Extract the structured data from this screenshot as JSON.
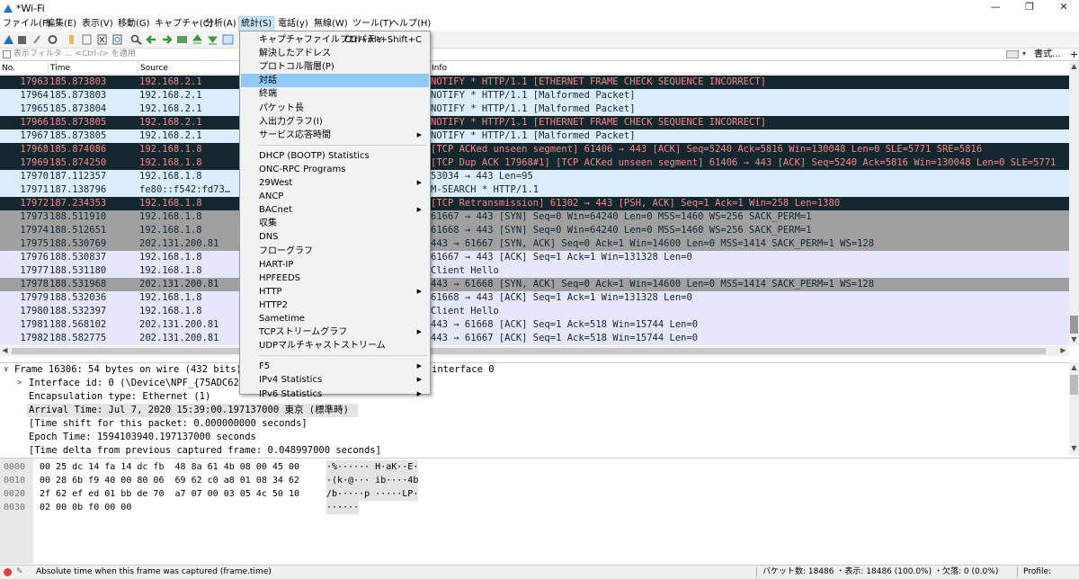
{
  "window": {
    "title": "*Wi-Fi",
    "min": "—",
    "max": "❐",
    "close": "✕"
  },
  "menubar": [
    {
      "label": "ファイル(F)"
    },
    {
      "label": "編集(E)"
    },
    {
      "label": "表示(V)"
    },
    {
      "label": "移動(G)"
    },
    {
      "label": "キャプチャ(C)"
    },
    {
      "label": "分析(A)"
    },
    {
      "label": "統計(S)"
    },
    {
      "label": "電話(y)"
    },
    {
      "label": "無線(W)"
    },
    {
      "label": "ツール(T)"
    },
    {
      "label": "ヘルプ(H)"
    }
  ],
  "filter": {
    "placeholder": "表示フィルタ … <Ctrl-/> を適用",
    "expression_label": "書式…",
    "plus": "+",
    "dropdown": "▾"
  },
  "columns": {
    "no": "No.",
    "time": "Time",
    "source": "Source",
    "info": "Info"
  },
  "packets": [
    {
      "no": "17963",
      "time": "185.873803",
      "src": "192.168.2.1",
      "info": "NOTIFY * HTTP/1.1  [ETHERNET FRAME CHECK SEQUENCE INCORRECT]",
      "style": "black"
    },
    {
      "no": "17964",
      "time": "185.873803",
      "src": "192.168.2.1",
      "info": "NOTIFY * HTTP/1.1 [Malformed Packet]",
      "style": "blue"
    },
    {
      "no": "17965",
      "time": "185.873804",
      "src": "192.168.2.1",
      "info": "NOTIFY * HTTP/1.1 [Malformed Packet]",
      "style": "blue"
    },
    {
      "no": "17966",
      "time": "185.873805",
      "src": "192.168.2.1",
      "info": "NOTIFY * HTTP/1.1  [ETHERNET FRAME CHECK SEQUENCE INCORRECT]",
      "style": "black"
    },
    {
      "no": "17967",
      "time": "185.873805",
      "src": "192.168.2.1",
      "info": "NOTIFY * HTTP/1.1 [Malformed Packet]",
      "style": "blue"
    },
    {
      "no": "17968",
      "time": "185.874086",
      "src": "192.168.1.8",
      "info": "[TCP ACKed unseen segment] 61406 → 443 [ACK] Seq=5240 Ack=5816 Win=130048 Len=0 SLE=5771 SRE=5816",
      "style": "black"
    },
    {
      "no": "17969",
      "time": "185.874250",
      "src": "192.168.1.8",
      "info": "[TCP Dup ACK 17968#1] [TCP ACKed unseen segment] 61406 → 443 [ACK] Seq=5240 Ack=5816 Win=130048 Len=0 SLE=5771",
      "style": "black"
    },
    {
      "no": "17970",
      "time": "187.112357",
      "src": "192.168.1.8",
      "info": "53034 → 443 Len=95",
      "style": "blue"
    },
    {
      "no": "17971",
      "time": "187.138796",
      "src": "fe80::f542:fd73…",
      "info": "M-SEARCH * HTTP/1.1",
      "style": "blue"
    },
    {
      "no": "17972",
      "time": "187.234353",
      "src": "192.168.1.8",
      "info": "[TCP Retransmission] 61302 → 443 [PSH, ACK] Seq=1 Ack=1 Win=258 Len=1380",
      "style": "black"
    },
    {
      "no": "17973",
      "time": "188.511910",
      "src": "192.168.1.8",
      "info": "61667 → 443 [SYN] Seq=0 Win=64240 Len=0 MSS=1460 WS=256 SACK_PERM=1",
      "style": "gray"
    },
    {
      "no": "17974",
      "time": "188.512651",
      "src": "192.168.1.8",
      "info": "61668 → 443 [SYN] Seq=0 Win=64240 Len=0 MSS=1460 WS=256 SACK_PERM=1",
      "style": "gray"
    },
    {
      "no": "17975",
      "time": "188.530769",
      "src": "202.131.200.81",
      "info": "443 → 61667 [SYN, ACK] Seq=0 Ack=1 Win=14600 Len=0 MSS=1414 SACK_PERM=1 WS=128",
      "style": "gray"
    },
    {
      "no": "17976",
      "time": "188.530837",
      "src": "192.168.1.8",
      "info": "61667 → 443 [ACK] Seq=1 Ack=1 Win=131328 Len=0",
      "style": "lav"
    },
    {
      "no": "17977",
      "time": "188.531180",
      "src": "192.168.1.8",
      "info": "Client Hello",
      "style": "lav"
    },
    {
      "no": "17978",
      "time": "188.531968",
      "src": "202.131.200.81",
      "info": "443 → 61668 [SYN, ACK] Seq=0 Ack=1 Win=14600 Len=0 MSS=1414 SACK_PERM=1 WS=128",
      "style": "gray"
    },
    {
      "no": "17979",
      "time": "188.532036",
      "src": "192.168.1.8",
      "info": "61668 → 443 [ACK] Seq=1 Ack=1 Win=131328 Len=0",
      "style": "lav"
    },
    {
      "no": "17980",
      "time": "188.532397",
      "src": "192.168.1.8",
      "info": "Client Hello",
      "style": "lav"
    },
    {
      "no": "17981",
      "time": "188.568102",
      "src": "202.131.200.81",
      "info": "443 → 61668 [ACK] Seq=1 Ack=518 Win=15744 Len=0",
      "style": "lav"
    },
    {
      "no": "17982",
      "time": "188.582775",
      "src": "202.131.200.81",
      "info": "443 → 61667 [ACK] Seq=1 Ack=518 Win=15744 Len=0",
      "style": "lav"
    }
  ],
  "details": [
    {
      "text": "Frame 16306: 54 bytes on wire (432 bits)",
      "expander": "∨",
      "indent": 0
    },
    {
      "text": "Interface id: 0 (\\Device\\NPF_{75ADC62",
      "expander": ">",
      "indent": 1
    },
    {
      "text": "Encapsulation type: Ethernet (1)",
      "expander": "",
      "indent": 1
    },
    {
      "text": "Arrival Time: Jul  7, 2020 15:39:00.197137000 東京 (標準時)",
      "expander": "",
      "indent": 1,
      "selected": true
    },
    {
      "text": "[Time shift for this packet: 0.000000000 seconds]",
      "expander": "",
      "indent": 1
    },
    {
      "text": "Epoch Time: 1594103940.197137000 seconds",
      "expander": "",
      "indent": 1
    },
    {
      "text": "[Time delta from previous captured frame: 0.048997000 seconds]",
      "expander": "",
      "indent": 1
    }
  ],
  "details_tail": "interface 0",
  "hex": [
    {
      "offset": "0000",
      "bytes": "00 25 dc 14 fa 14 dc fb  48 8a 61 4b 08 00 45 00",
      "ascii": "·%······ H·aK··E·"
    },
    {
      "offset": "0010",
      "bytes": "00 28 6b f9 40 00 80 06  69 62 c0 a8 01 08 34 62",
      "ascii": "·(k·@··· ib····4b"
    },
    {
      "offset": "0020",
      "bytes": "2f 62 ef ed 01 bb de 70  a7 07 00 03 05 4c 50 10",
      "ascii": "/b·····p ·····LP·"
    },
    {
      "offset": "0030",
      "bytes": "02 00 0b f0 00 00",
      "ascii": "······"
    }
  ],
  "statusbar": {
    "hint": "Absolute time when this frame was captured (frame.time)",
    "stats": "パケット数: 18486 ・表示: 18486 (100.0%) ・欠落: 0 (0.0%)",
    "profile": "Profile: Default"
  },
  "stats_menu": {
    "items": [
      {
        "label": "キャプチャファイルプロパティ",
        "shortcut": "Ctrl+Alt+Shift+C"
      },
      {
        "label": "解決したアドレス"
      },
      {
        "label": "プロトコル階層(P)"
      },
      {
        "label": "対話",
        "highlighted": true
      },
      {
        "label": "終端"
      },
      {
        "label": "パケット長"
      },
      {
        "label": "入出力グラフ(I)"
      },
      {
        "label": "サービス応答時間",
        "submenu": true
      },
      {
        "sep": true
      },
      {
        "label": "DHCP (BOOTP) Statistics"
      },
      {
        "label": "ONC-RPC Programs"
      },
      {
        "label": "29West",
        "submenu": true
      },
      {
        "label": "ANCP"
      },
      {
        "label": "BACnet",
        "submenu": true
      },
      {
        "label": "収集"
      },
      {
        "label": "DNS"
      },
      {
        "label": "フローグラフ"
      },
      {
        "label": "HART-IP"
      },
      {
        "label": "HPFEEDS"
      },
      {
        "label": "HTTP",
        "submenu": true
      },
      {
        "label": "HTTP2"
      },
      {
        "label": "Sametime"
      },
      {
        "label": "TCPストリームグラフ",
        "submenu": true
      },
      {
        "label": "UDPマルチキャストストリーム"
      },
      {
        "sep": true
      },
      {
        "label": "F5",
        "submenu": true
      },
      {
        "label": "IPv4 Statistics",
        "submenu": true
      },
      {
        "label": "IPv6 Statistics",
        "submenu": true
      }
    ],
    "submenu_glyph": "▶"
  },
  "colors": {
    "row_black_bg": "#12272e",
    "row_black_fg": "#f78787",
    "row_blue_bg": "#daeeff",
    "row_gray_bg": "#a0a0a0",
    "row_lav_bg": "#e7e6ff",
    "menu_highlight": "#91c9f7"
  },
  "icons": [
    "shark-fin-icon",
    "stop-icon",
    "restart-icon",
    "options-icon",
    "open-icon",
    "save-icon",
    "close-file-icon",
    "reload-icon",
    "find-icon",
    "back-icon",
    "forward-icon",
    "goto-icon",
    "first-icon",
    "last-icon",
    "autoscroll-icon"
  ]
}
